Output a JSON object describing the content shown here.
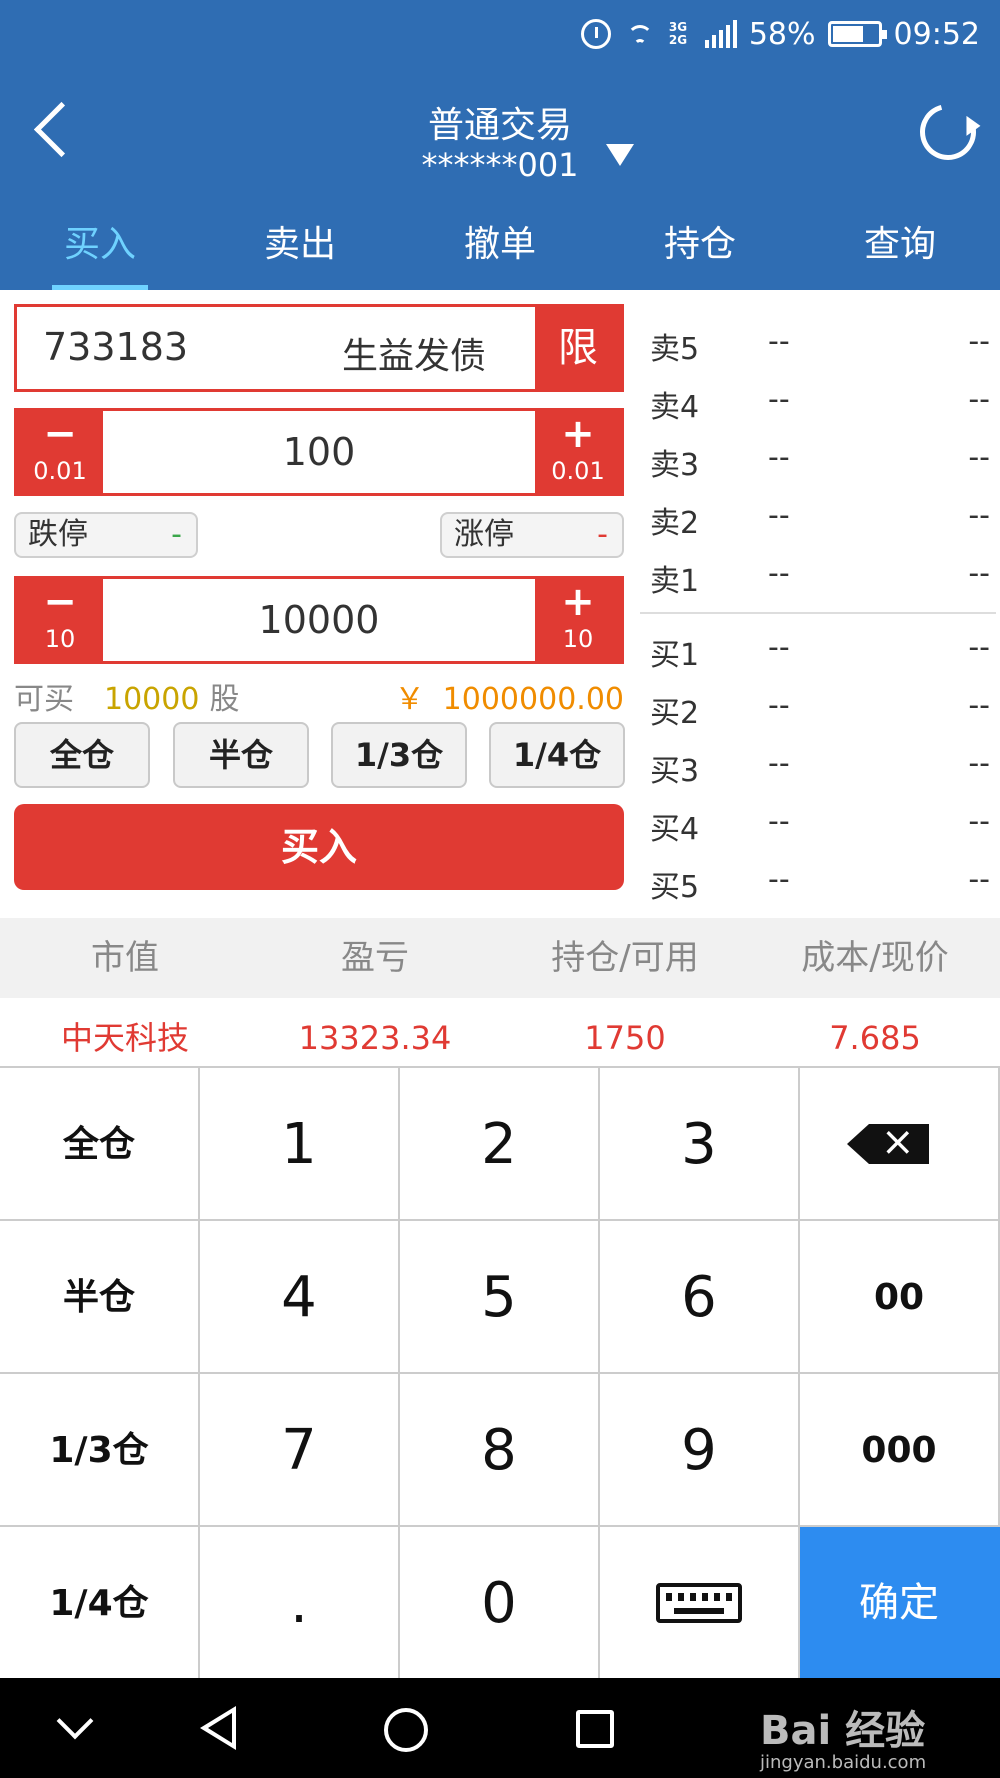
{
  "status_bar": {
    "network": "3G 2G",
    "battery": "58%",
    "time": "09:52"
  },
  "header": {
    "title": "普通交易",
    "account": "******001"
  },
  "tabs": [
    "买入",
    "卖出",
    "撤单",
    "持仓",
    "查询"
  ],
  "stock": {
    "code": "733183",
    "name": "生益发债",
    "limit_label": "限"
  },
  "price_stepper": {
    "minus_step": "0.01",
    "value": "100",
    "plus_step": "0.01"
  },
  "limits": {
    "down_label": "跌停",
    "down_value": "-",
    "up_label": "涨停",
    "up_value": "-"
  },
  "qty_stepper": {
    "minus_step": "10",
    "value": "10000",
    "plus_step": "10"
  },
  "available": {
    "label": "可买",
    "value": "10000",
    "unit": "股",
    "currency": "￥",
    "amount": "1000000.00"
  },
  "position_buttons": [
    "全仓",
    "半仓",
    "1/3仓",
    "1/4仓"
  ],
  "buy_button": "买入",
  "order_book": {
    "asks": [
      {
        "label": "卖5",
        "price": "--",
        "volume": "--"
      },
      {
        "label": "卖4",
        "price": "--",
        "volume": "--"
      },
      {
        "label": "卖3",
        "price": "--",
        "volume": "--"
      },
      {
        "label": "卖2",
        "price": "--",
        "volume": "--"
      },
      {
        "label": "卖1",
        "price": "--",
        "volume": "--"
      }
    ],
    "bids": [
      {
        "label": "买1",
        "price": "--",
        "volume": "--"
      },
      {
        "label": "买2",
        "price": "--",
        "volume": "--"
      },
      {
        "label": "买3",
        "price": "--",
        "volume": "--"
      },
      {
        "label": "买4",
        "price": "--",
        "volume": "--"
      },
      {
        "label": "买5",
        "price": "--",
        "volume": "--"
      }
    ]
  },
  "positions": {
    "headers": [
      "市值",
      "盈亏",
      "持仓/可用",
      "成本/现价"
    ],
    "rows": [
      [
        "中天科技",
        "13323.34",
        "1750",
        "7.685"
      ]
    ]
  },
  "keypad": {
    "left": [
      "全仓",
      "半仓",
      "1/3仓",
      "1/4仓"
    ],
    "digits": [
      "1",
      "2",
      "3",
      "4",
      "5",
      "6",
      "7",
      "8",
      "9",
      ".",
      "0"
    ],
    "extra": [
      "00",
      "000"
    ],
    "confirm": "确定",
    "backspace_icon": "backspace-icon",
    "keyboard_icon": "keyboard-icon"
  },
  "watermark": {
    "brand": "Bai 经验",
    "url": "jingyan.baidu.com"
  },
  "colors": {
    "header": "#2f6db3",
    "accent_red": "#e03a33",
    "confirm_blue": "#2d8cf0",
    "active_tab": "#6fd2ff"
  }
}
